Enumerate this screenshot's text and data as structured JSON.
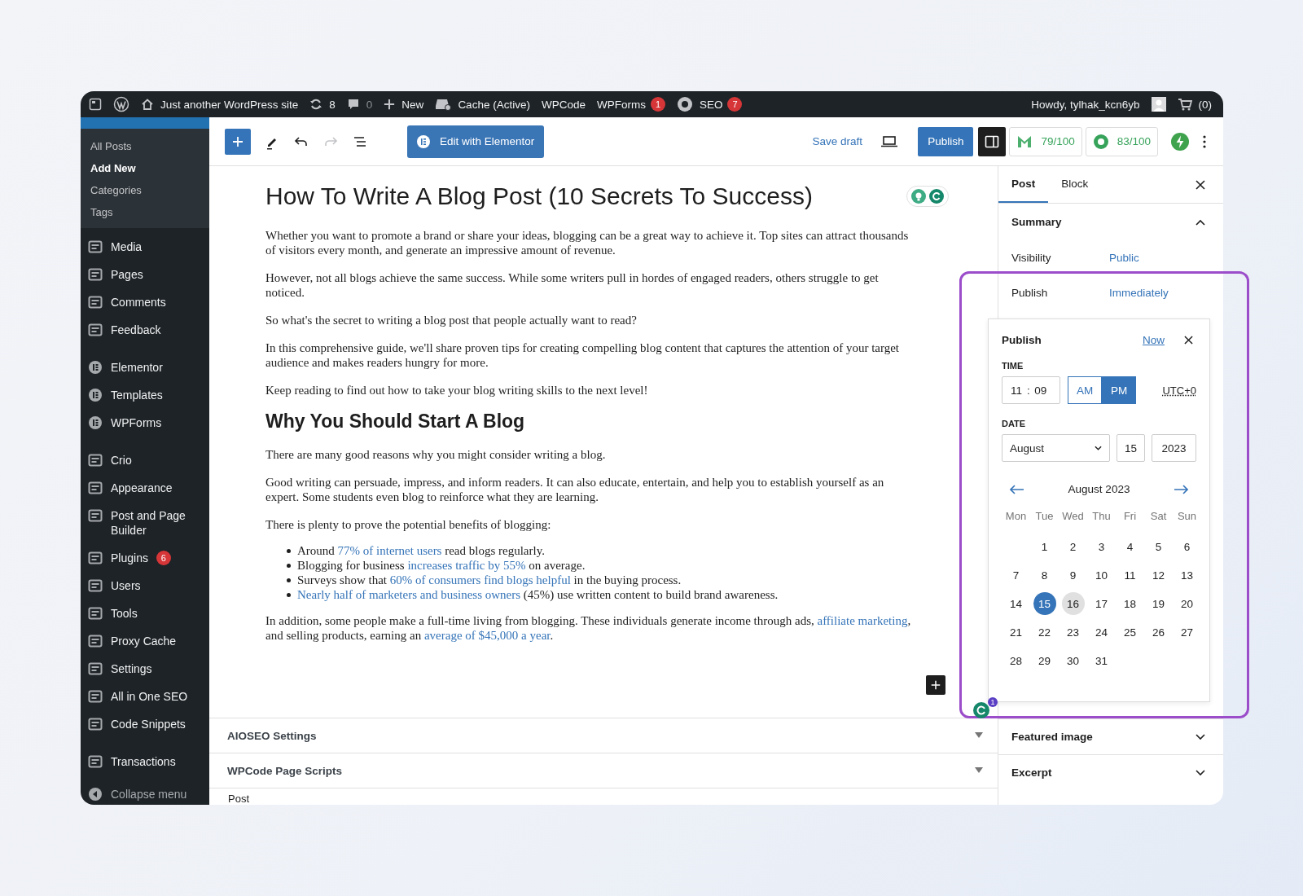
{
  "admin_bar": {
    "site_name": "Just another WordPress site",
    "updates": "8",
    "comments": "0",
    "new_label": "New",
    "cache": "Cache (Active)",
    "wpcode": "WPCode",
    "wpforms": {
      "label": "WPForms",
      "badge": "1"
    },
    "seo": {
      "label": "SEO",
      "badge": "7"
    },
    "greeting": "Howdy, tylhak_kcn6yb",
    "cart": "(0)"
  },
  "sidebar": {
    "submenu": [
      {
        "label": "All Posts",
        "selected": false
      },
      {
        "label": "Add New",
        "selected": true
      },
      {
        "label": "Categories",
        "selected": false
      },
      {
        "label": "Tags",
        "selected": false
      }
    ],
    "groups": [
      {
        "items": [
          {
            "label": "Media"
          },
          {
            "label": "Pages"
          },
          {
            "label": "Comments"
          },
          {
            "label": "Feedback"
          }
        ]
      },
      {
        "items": [
          {
            "label": "Elementor"
          },
          {
            "label": "Templates"
          },
          {
            "label": "WPForms"
          }
        ]
      },
      {
        "items": [
          {
            "label": "Crio"
          },
          {
            "label": "Appearance"
          },
          {
            "label": "Post and Page Builder"
          },
          {
            "label": "Plugins",
            "badge": "6"
          },
          {
            "label": "Users"
          },
          {
            "label": "Tools"
          },
          {
            "label": "Proxy Cache"
          },
          {
            "label": "Settings"
          },
          {
            "label": "All in One SEO"
          },
          {
            "label": "Code Snippets"
          }
        ]
      },
      {
        "items": [
          {
            "label": "Transactions"
          }
        ]
      }
    ],
    "collapse_label": "Collapse menu"
  },
  "toolbar": {
    "redo_disabled": true,
    "elementor_button": "Edit with Elementor",
    "save_draft": "Save draft",
    "publish": "Publish",
    "settings_active": true,
    "scores": [
      "79/100",
      "83/100"
    ]
  },
  "post": {
    "title": "How To Write A Blog Post (10 Secrets To Success)",
    "blocks": [
      {
        "kind": "paragraph",
        "parts": [
          {
            "text": "Whether you want to promote a brand or share your ideas, blogging can be a great way to achieve it. Top sites can attract thousands of visitors every month, and generate an impressive amount of revenue.",
            "link": false
          }
        ]
      },
      {
        "kind": "paragraph",
        "parts": [
          {
            "text": "However, not all blogs achieve the same success. While some writers pull in hordes of engaged readers, others struggle to get noticed.",
            "link": false
          }
        ]
      },
      {
        "kind": "paragraph",
        "parts": [
          {
            "text": "So what's the secret to writing a blog post that people actually want to read?",
            "link": false
          }
        ]
      },
      {
        "kind": "paragraph",
        "parts": [
          {
            "text": "In this comprehensive guide, we'll share proven tips for creating compelling blog content that captures the attention of your target audience and makes readers hungry for more.",
            "link": false
          }
        ]
      },
      {
        "kind": "paragraph",
        "parts": [
          {
            "text": "Keep reading to find out how to take your blog writing skills to the next level!",
            "link": false
          }
        ]
      },
      {
        "kind": "heading",
        "text": "Why You Should Start A Blog"
      },
      {
        "kind": "paragraph",
        "parts": [
          {
            "text": "There are many good reasons why you might consider writing a blog.",
            "link": false
          }
        ]
      },
      {
        "kind": "paragraph",
        "parts": [
          {
            "text": "Good writing can persuade, impress, and inform readers. It can also educate, entertain, and help you to establish yourself as an expert. Some students even blog to reinforce what they are learning.",
            "link": false
          }
        ]
      },
      {
        "kind": "paragraph",
        "parts": [
          {
            "text": "There is plenty to prove the potential benefits of blogging:",
            "link": false
          }
        ]
      },
      {
        "kind": "list",
        "items": [
          [
            {
              "text": "Around ",
              "link": false
            },
            {
              "text": "77% of internet users",
              "link": true
            },
            {
              "text": " read blogs regularly.",
              "link": false
            }
          ],
          [
            {
              "text": "Blogging for business ",
              "link": false
            },
            {
              "text": "increases traffic by 55%",
              "link": true
            },
            {
              "text": " on average.",
              "link": false
            }
          ],
          [
            {
              "text": "Surveys show that ",
              "link": false
            },
            {
              "text": "60% of consumers find blogs helpful",
              "link": true
            },
            {
              "text": " in the buying process.",
              "link": false
            }
          ],
          [
            {
              "text": "Nearly half of marketers and business owners",
              "link": true
            },
            {
              "text": " (45%) use written content to build brand awareness.",
              "link": false
            }
          ]
        ]
      },
      {
        "kind": "paragraph",
        "parts": [
          {
            "text": "In addition, some people make a full-time living from blogging. These individuals generate income through ads, ",
            "link": false
          },
          {
            "text": "affiliate marketing",
            "link": true
          },
          {
            "text": ", and selling products, earning an ",
            "link": false
          },
          {
            "text": "average of $45,000 a year",
            "link": true
          },
          {
            "text": ".",
            "link": false
          }
        ]
      }
    ]
  },
  "metaboxes": [
    {
      "label": "AIOSEO Settings",
      "expanded": false
    },
    {
      "label": "WPCode Page Scripts",
      "expanded": false
    }
  ],
  "breadcrumb": "Post",
  "floating_badge": "1",
  "panel": {
    "tabs": [
      {
        "label": "Post",
        "selected": true
      },
      {
        "label": "Block",
        "selected": false
      }
    ],
    "summary": {
      "label": "Summary",
      "expanded": true,
      "rows": [
        {
          "label": "Visibility",
          "value": "Public"
        },
        {
          "label": "Publish",
          "value": "Immediately"
        }
      ]
    },
    "sections": [
      {
        "label": "Featured image",
        "expanded": false
      },
      {
        "label": "Excerpt",
        "expanded": false
      }
    ]
  },
  "popover": {
    "title": "Publish",
    "now": "Now",
    "time_label": "TIME",
    "hours": "11",
    "separator": ":",
    "minutes": "09",
    "meridiem": [
      {
        "label": "AM",
        "selected": false
      },
      {
        "label": "PM",
        "selected": true
      }
    ],
    "timezone": "UTC+0",
    "date_label": "DATE",
    "month": "August",
    "day": "15",
    "year": "2023",
    "calendar_title": "August 2023",
    "weekdays": [
      "Mon",
      "Tue",
      "Wed",
      "Thu",
      "Fri",
      "Sat",
      "Sun"
    ],
    "weeks": [
      [
        {
          "label": "1",
          "selected": false,
          "highlighted": false
        },
        {
          "label": "2",
          "selected": false,
          "highlighted": false
        },
        {
          "label": "3",
          "selected": false,
          "highlighted": false
        },
        {
          "label": "4",
          "selected": false,
          "highlighted": false
        },
        {
          "label": "5",
          "selected": false,
          "highlighted": false
        },
        {
          "label": "6",
          "selected": false,
          "highlighted": false
        }
      ],
      [
        {
          "label": "7",
          "selected": false,
          "highlighted": false
        },
        {
          "label": "8",
          "selected": false,
          "highlighted": false
        },
        {
          "label": "9",
          "selected": false,
          "highlighted": false
        },
        {
          "label": "10",
          "selected": false,
          "highlighted": false
        },
        {
          "label": "11",
          "selected": false,
          "highlighted": false
        },
        {
          "label": "12",
          "selected": false,
          "highlighted": false
        },
        {
          "label": "13",
          "selected": false,
          "highlighted": false
        }
      ],
      [
        {
          "label": "14",
          "selected": false,
          "highlighted": false
        },
        {
          "label": "15",
          "selected": true,
          "highlighted": false
        },
        {
          "label": "16",
          "selected": false,
          "highlighted": true
        },
        {
          "label": "17",
          "selected": false,
          "highlighted": false
        },
        {
          "label": "18",
          "selected": false,
          "highlighted": false
        },
        {
          "label": "19",
          "selected": false,
          "highlighted": false
        },
        {
          "label": "20",
          "selected": false,
          "highlighted": false
        }
      ],
      [
        {
          "label": "21",
          "selected": false,
          "highlighted": false
        },
        {
          "label": "22",
          "selected": false,
          "highlighted": false
        },
        {
          "label": "23",
          "selected": false,
          "highlighted": false
        },
        {
          "label": "24",
          "selected": false,
          "highlighted": false
        },
        {
          "label": "25",
          "selected": false,
          "highlighted": false
        },
        {
          "label": "26",
          "selected": false,
          "highlighted": false
        },
        {
          "label": "27",
          "selected": false,
          "highlighted": false
        }
      ],
      [
        {
          "label": "28",
          "selected": false,
          "highlighted": false
        },
        {
          "label": "29",
          "selected": false,
          "highlighted": false
        },
        {
          "label": "30",
          "selected": false,
          "highlighted": false
        },
        {
          "label": "31",
          "selected": false,
          "highlighted": false
        }
      ]
    ]
  }
}
